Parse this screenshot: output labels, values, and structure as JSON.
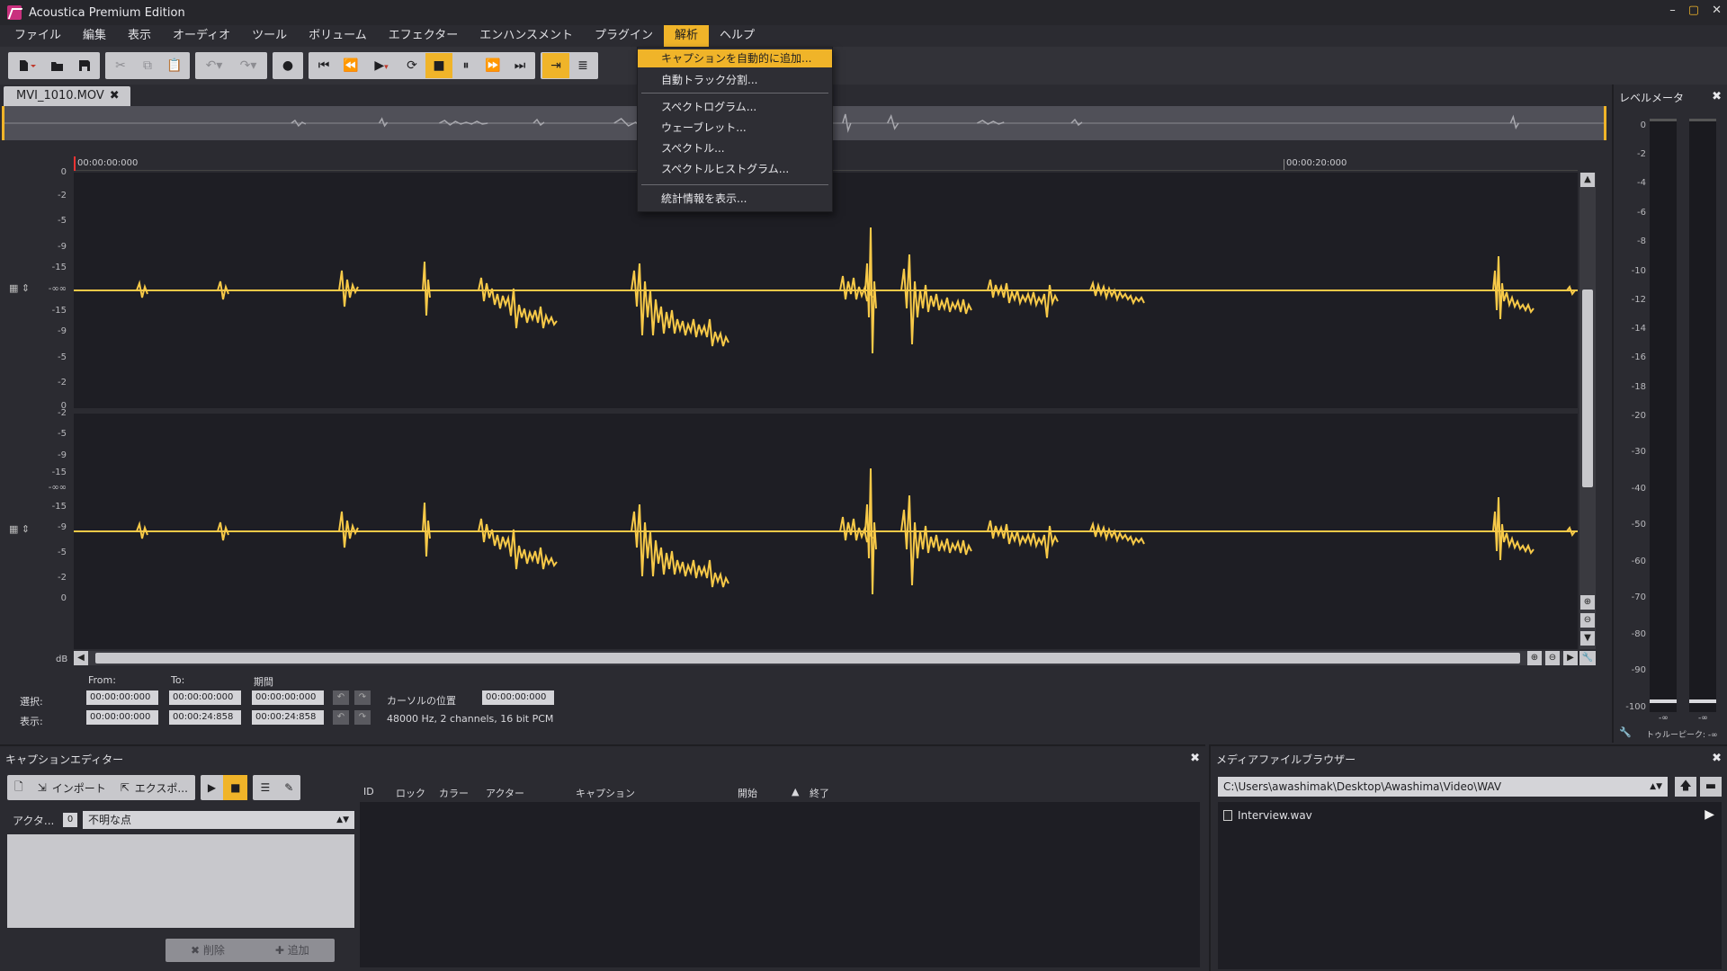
{
  "app": {
    "title": "Acoustica Premium Edition",
    "window_controls": [
      "–",
      "▢",
      "✕"
    ]
  },
  "menu": {
    "items": [
      "ファイル",
      "編集",
      "表示",
      "オーディオ",
      "ツール",
      "ボリューム",
      "エフェクター",
      "エンハンスメント",
      "プラグイン",
      "解析",
      "ヘルプ"
    ],
    "active_index": 9
  },
  "dropdown": {
    "items": [
      {
        "label": "キャプションを自動的に追加...",
        "active": true
      },
      {
        "label": "自動トラック分割...",
        "active": false
      },
      {
        "label": "スペクトログラム...",
        "active": false
      },
      {
        "label": "ウェーブレット...",
        "active": false
      },
      {
        "label": "スペクトル...",
        "active": false
      },
      {
        "label": "スペクトルヒストグラム...",
        "active": false
      },
      {
        "label": "統計情報を表示...",
        "active": false
      }
    ]
  },
  "document": {
    "tab_label": "MVI_1010.MOV",
    "ruler": {
      "start_label": "00:00:00:000",
      "mark_label": "00:00:20:000"
    },
    "db_labels": [
      "0",
      "-2",
      "-5",
      "-9",
      "-15",
      "-∞∞",
      "-15",
      "-9",
      "-5",
      "-2",
      "0"
    ],
    "db_unit": "dB"
  },
  "selection": {
    "headers": {
      "from": "From:",
      "to": "To:",
      "duration": "期間"
    },
    "rows": [
      {
        "label": "選択:",
        "from": "00:00:00:000",
        "to": "00:00:00:000",
        "duration": "00:00:00:000"
      },
      {
        "label": "表示:",
        "from": "00:00:00:000",
        "to": "00:00:24:858",
        "duration": "00:00:24:858"
      }
    ],
    "cursor_label": "カーソルの位置",
    "cursor_value": "00:00:00:000",
    "format_info": "48000 Hz, 2 channels, 16 bit PCM"
  },
  "level_meter": {
    "title": "レベルメータ",
    "scale": [
      "0",
      "-2",
      "-4",
      "-6",
      "-8",
      "-10",
      "-12",
      "-14",
      "-16",
      "-18",
      "-20",
      "-30",
      "-40",
      "-50",
      "-60",
      "-70",
      "-80",
      "-90",
      "-100"
    ],
    "left_peak": "-∞",
    "right_peak": "-∞",
    "true_peak": "トゥルーピーク: -∞"
  },
  "caption_editor": {
    "title": "キャプションエディター",
    "import_label": "インポート",
    "export_label": "エクスポ...",
    "actor_label": "アクタ...",
    "actor_num": "0",
    "actor_value": "不明な点",
    "delete_label": "削除",
    "add_label": "追加",
    "columns": [
      "ID",
      "ロック",
      "カラー",
      "アクター",
      "キャプション",
      "開始",
      "終了"
    ]
  },
  "media_browser": {
    "title": "メディアファイルブラウザー",
    "path": "C:\\Users\\awashimak\\Desktop\\Awashima\\Video\\WAV",
    "files": [
      "Interview.wav"
    ]
  },
  "colors": {
    "accent": "#f0b429",
    "waveform": "#f7c948",
    "background": "#2b2b31",
    "wave_bg": "#1e1e24"
  }
}
